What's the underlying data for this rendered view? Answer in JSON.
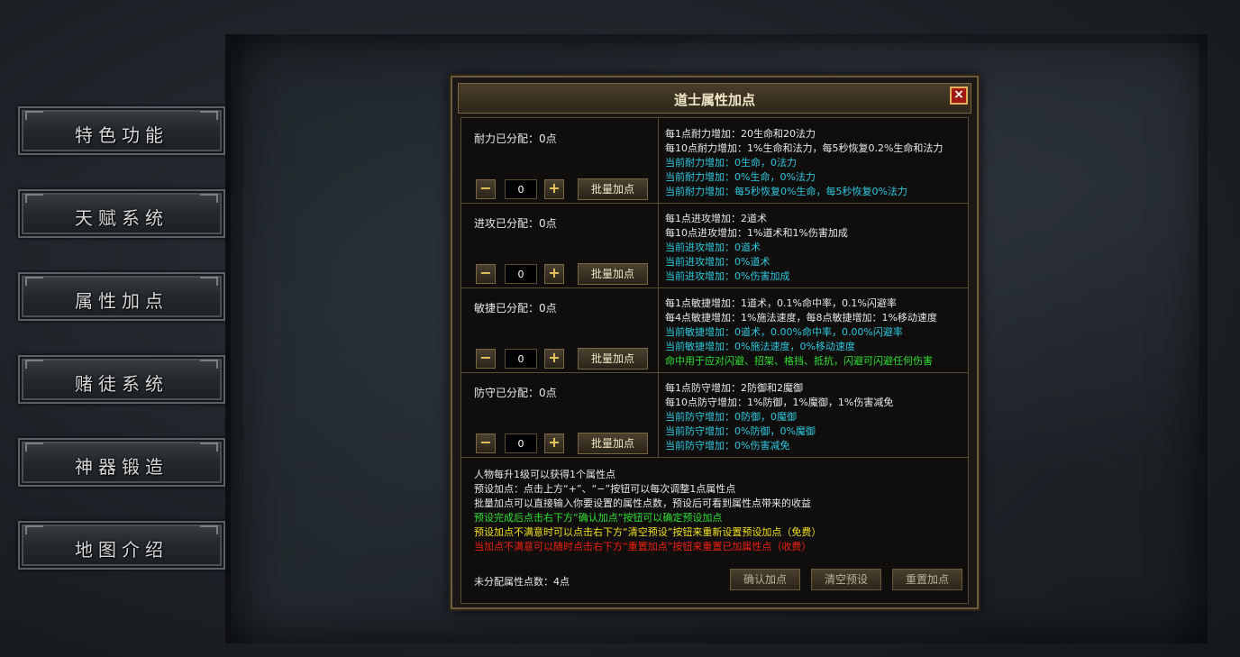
{
  "nav": {
    "items": [
      {
        "label": "特色功能"
      },
      {
        "label": "天赋系统"
      },
      {
        "label": "属性加点"
      },
      {
        "label": "赌徒系统"
      },
      {
        "label": "神器锻造"
      },
      {
        "label": "地图介绍"
      }
    ]
  },
  "dialog": {
    "title": "道士属性加点",
    "close_icon": "×",
    "controls": {
      "minus": "−",
      "plus": "+",
      "bulk_label": "批量加点",
      "value": "0"
    },
    "rows": [
      {
        "alloc": "耐力已分配：0点",
        "lines": [
          {
            "text": "每1点耐力增加：20生命和20法力",
            "color": "white"
          },
          {
            "text": "每10点耐力增加：1%生命和法力，每5秒恢复0.2%生命和法力",
            "color": "white"
          },
          {
            "text": "当前耐力增加：0生命，0法力",
            "color": "cyan"
          },
          {
            "text": "当前耐力增加：0%生命，0%法力",
            "color": "cyan"
          },
          {
            "text": "当前耐力增加：每5秒恢复0%生命，每5秒恢复0%法力",
            "color": "cyan"
          }
        ]
      },
      {
        "alloc": "进攻已分配：0点",
        "lines": [
          {
            "text": "每1点进攻增加：2道术",
            "color": "white"
          },
          {
            "text": "每10点进攻增加：1%道术和1%伤害加成",
            "color": "white"
          },
          {
            "text": "当前进攻增加：0道术",
            "color": "cyan"
          },
          {
            "text": "当前进攻增加：0%道术",
            "color": "cyan"
          },
          {
            "text": "当前进攻增加：0%伤害加成",
            "color": "cyan"
          }
        ]
      },
      {
        "alloc": "敏捷已分配：0点",
        "lines": [
          {
            "text": "每1点敏捷增加：1道术，0.1%命中率，0.1%闪避率",
            "color": "white"
          },
          {
            "text": "每4点敏捷增加：1%施法速度，每8点敏捷增加：1%移动速度",
            "color": "white"
          },
          {
            "text": "当前敏捷增加：0道术，0.00%命中率，0.00%闪避率",
            "color": "cyan"
          },
          {
            "text": "当前敏捷增加：0%施法速度，0%移动速度",
            "color": "cyan"
          },
          {
            "text": "命中用于应对闪避、招架、格挡、抵抗，闪避可闪避任何伤害",
            "color": "green"
          }
        ]
      },
      {
        "alloc": "防守已分配：0点",
        "lines": [
          {
            "text": "每1点防守增加：2防御和2魔御",
            "color": "white"
          },
          {
            "text": "每10点防守增加：1%防御，1%魔御，1%伤害减免",
            "color": "white"
          },
          {
            "text": "当前防守增加：0防御，0魔御",
            "color": "cyan"
          },
          {
            "text": "当前防守增加：0%防御，0%魔御",
            "color": "cyan"
          },
          {
            "text": "当前防守增加：0%伤害减免",
            "color": "cyan"
          }
        ]
      }
    ],
    "notes": [
      {
        "text": "人物每升1级可以获得1个属性点",
        "color": "white"
      },
      {
        "text": "预设加点：点击上方“+”、“−”按钮可以每次调整1点属性点",
        "color": "white"
      },
      {
        "text": "批量加点可以直接输入你要设置的属性点数，预设后可看到属性点带来的收益",
        "color": "white"
      },
      {
        "text": "预设完成后点击右下方“确认加点”按钮可以确定预设加点",
        "color": "green"
      },
      {
        "text": "预设加点不满意时可以点击右下方“清空预设”按钮来重新设置预设加点（免费）",
        "color": "yellow"
      },
      {
        "text": "当加点不满意可以随时点击右下方“重置加点”按钮来重置已加属性点（收费）",
        "color": "red"
      }
    ],
    "unallocated": "未分配属性点数：4点",
    "buttons": {
      "confirm": "确认加点",
      "clear": "清空预设",
      "reset": "重置加点"
    }
  }
}
